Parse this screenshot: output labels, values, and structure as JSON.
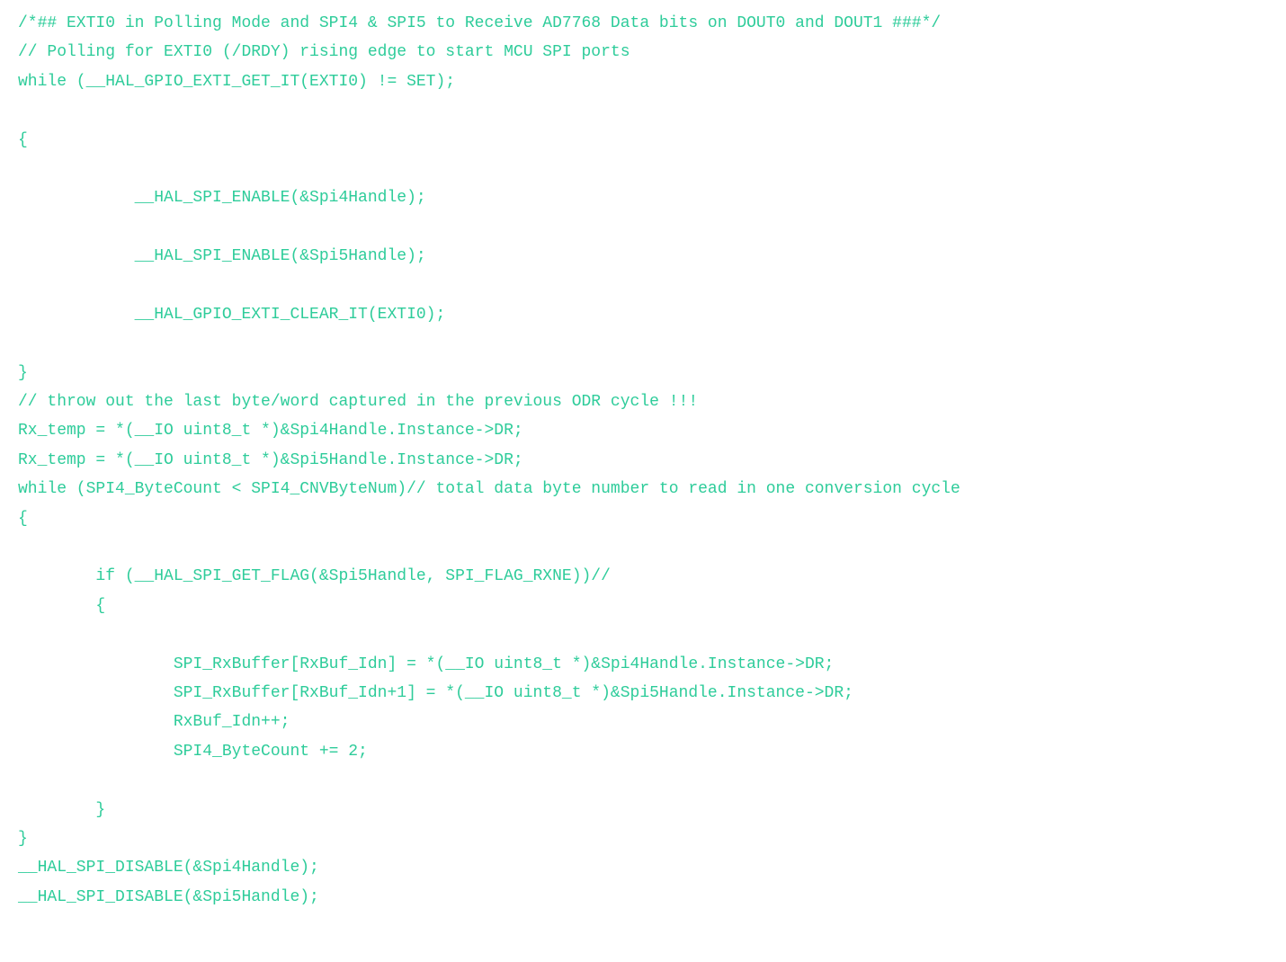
{
  "code": {
    "lines": [
      {
        "id": "line1",
        "text": "/*## EXTI0 in Polling Mode and SPI4 & SPI5 to Receive AD7768 Data bits on DOUT0 and DOUT1 ###*/",
        "type": "comment"
      },
      {
        "id": "line2",
        "text": "// Polling for EXTI0 (/DRDY) rising edge to start MCU SPI ports",
        "type": "comment"
      },
      {
        "id": "line3",
        "text": "while (__HAL_GPIO_EXTI_GET_IT(EXTI0) != SET);",
        "type": "code"
      },
      {
        "id": "line4",
        "text": "",
        "type": "empty"
      },
      {
        "id": "line5",
        "text": "{",
        "type": "code"
      },
      {
        "id": "line6",
        "text": "",
        "type": "empty"
      },
      {
        "id": "line7",
        "text": "            __HAL_SPI_ENABLE(&Spi4Handle);",
        "type": "code"
      },
      {
        "id": "line8",
        "text": "",
        "type": "empty"
      },
      {
        "id": "line9",
        "text": "            __HAL_SPI_ENABLE(&Spi5Handle);",
        "type": "code"
      },
      {
        "id": "line10",
        "text": "",
        "type": "empty"
      },
      {
        "id": "line11",
        "text": "            __HAL_GPIO_EXTI_CLEAR_IT(EXTI0);",
        "type": "code"
      },
      {
        "id": "line12",
        "text": "",
        "type": "empty"
      },
      {
        "id": "line13",
        "text": "}",
        "type": "code"
      },
      {
        "id": "line14",
        "text": "// throw out the last byte/word captured in the previous ODR cycle !!!",
        "type": "comment"
      },
      {
        "id": "line15",
        "text": "Rx_temp = *(__IO uint8_t *)&Spi4Handle.Instance->DR;",
        "type": "code"
      },
      {
        "id": "line16",
        "text": "Rx_temp = *(__IO uint8_t *)&Spi5Handle.Instance->DR;",
        "type": "code"
      },
      {
        "id": "line17",
        "text": "while (SPI4_ByteCount < SPI4_CNVByteNum)// total data byte number to read in one conversion cycle",
        "type": "code"
      },
      {
        "id": "line18",
        "text": "{",
        "type": "code"
      },
      {
        "id": "line19",
        "text": "",
        "type": "empty"
      },
      {
        "id": "line20",
        "text": "        if (__HAL_SPI_GET_FLAG(&Spi5Handle, SPI_FLAG_RXNE))//",
        "type": "code"
      },
      {
        "id": "line21",
        "text": "        {",
        "type": "code"
      },
      {
        "id": "line22",
        "text": "",
        "type": "empty"
      },
      {
        "id": "line23",
        "text": "                SPI_RxBuffer[RxBuf_Idn] = *(__IO uint8_t *)&Spi4Handle.Instance->DR;",
        "type": "code"
      },
      {
        "id": "line24",
        "text": "                SPI_RxBuffer[RxBuf_Idn+1] = *(__IO uint8_t *)&Spi5Handle.Instance->DR;",
        "type": "code"
      },
      {
        "id": "line25",
        "text": "                RxBuf_Idn++;",
        "type": "code"
      },
      {
        "id": "line26",
        "text": "                SPI4_ByteCount += 2;",
        "type": "code"
      },
      {
        "id": "line27",
        "text": "",
        "type": "empty"
      },
      {
        "id": "line28",
        "text": "        }",
        "type": "code"
      },
      {
        "id": "line29",
        "text": "}",
        "type": "code"
      },
      {
        "id": "line30",
        "text": "__HAL_SPI_DISABLE(&Spi4Handle);",
        "type": "code"
      },
      {
        "id": "line31",
        "text": "__HAL_SPI_DISABLE(&Spi5Handle);",
        "type": "code"
      }
    ]
  }
}
